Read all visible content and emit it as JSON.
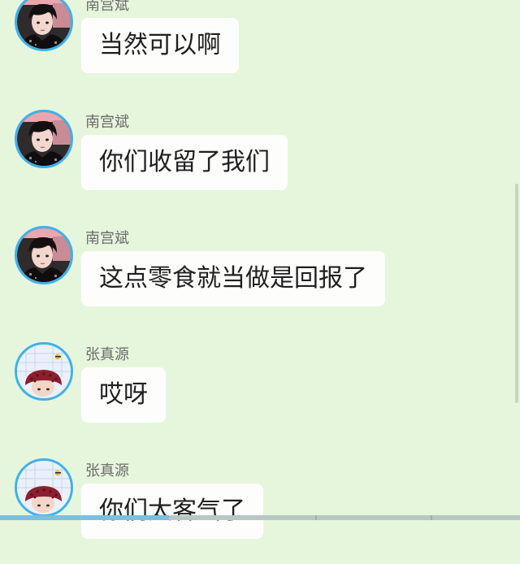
{
  "colors": {
    "background": "#e6f6dc",
    "bubble": "#fdfefc",
    "avatar_ring": "#3eb1ea",
    "name_text": "#6b6b6b"
  },
  "messages": [
    {
      "sender": "南宫斌",
      "text": "当然可以啊",
      "avatar_icon": "boy-dark-hair-avatar"
    },
    {
      "sender": "南宫斌",
      "text": "你们收留了我们",
      "avatar_icon": "boy-dark-hair-avatar"
    },
    {
      "sender": "南宫斌",
      "text": "这点零食就当做是回报了",
      "avatar_icon": "boy-dark-hair-avatar"
    },
    {
      "sender": "张真源",
      "text": "哎呀",
      "avatar_icon": "boy-red-hat-avatar"
    },
    {
      "sender": "张真源",
      "text": "你们太客气了",
      "avatar_icon": "boy-red-hat-avatar"
    }
  ]
}
